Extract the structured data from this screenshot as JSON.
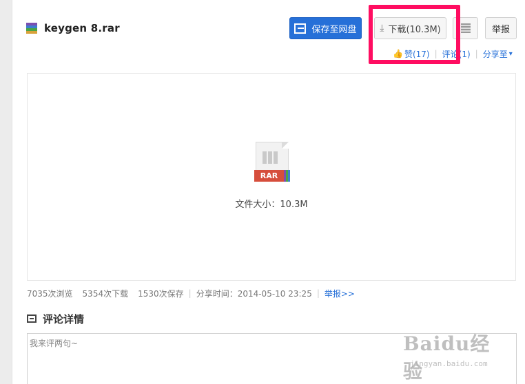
{
  "file": {
    "name": "keygen 8.rar"
  },
  "toolbar": {
    "save_label": "保存至网盘",
    "download_label": "下载(10.3M)",
    "report_label": "举报"
  },
  "actions": {
    "like_label": "赞(17)",
    "comment_label": "评论(1)",
    "share_label": "分享至"
  },
  "preview": {
    "file_type_label": "RAR",
    "size_text": "文件大小：10.3M"
  },
  "stats": {
    "views": "7035次浏览",
    "downloads": "5354次下载",
    "saves": "1530次保存",
    "share_time": "分享时间：2014-05-10 23:25",
    "report_link": "举报>>"
  },
  "comments": {
    "heading": "评论详情",
    "placeholder": "我来评两句~"
  },
  "watermark": {
    "brand": "Baidu经验",
    "url": "jingyan.baidu.com"
  },
  "colors": {
    "accent_blue": "#2670d8",
    "highlight": "#ff0d61",
    "rar_red": "#d64e3c"
  }
}
